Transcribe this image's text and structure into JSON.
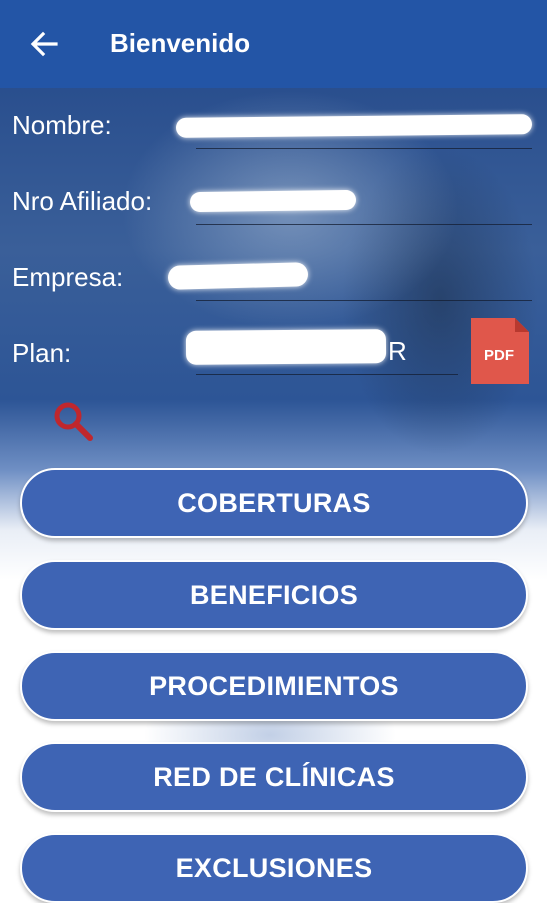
{
  "header": {
    "title": "Bienvenido"
  },
  "fields": {
    "nombre": {
      "label": "Nombre:",
      "value": ""
    },
    "afiliado": {
      "label": "Nro Afiliado:",
      "value": ""
    },
    "empresa": {
      "label": "Empresa:",
      "value": ""
    },
    "plan": {
      "label": "Plan:",
      "value": "R"
    }
  },
  "pdf": {
    "label": "PDF"
  },
  "buttons": {
    "coberturas": "COBERTURAS",
    "beneficios": "BENEFICIOS",
    "procedimientos": "PROCEDIMIENTOS",
    "red": "RED DE CLÍNICAS",
    "exclusiones": "EXCLUSIONES"
  },
  "icons": {
    "back": "arrow-left-icon",
    "search": "search-icon",
    "pdf": "pdf-file-icon"
  },
  "colors": {
    "header": "#2355a6",
    "button": "#3e64b4",
    "pdf": "#e0574b",
    "search": "#c0272d"
  }
}
